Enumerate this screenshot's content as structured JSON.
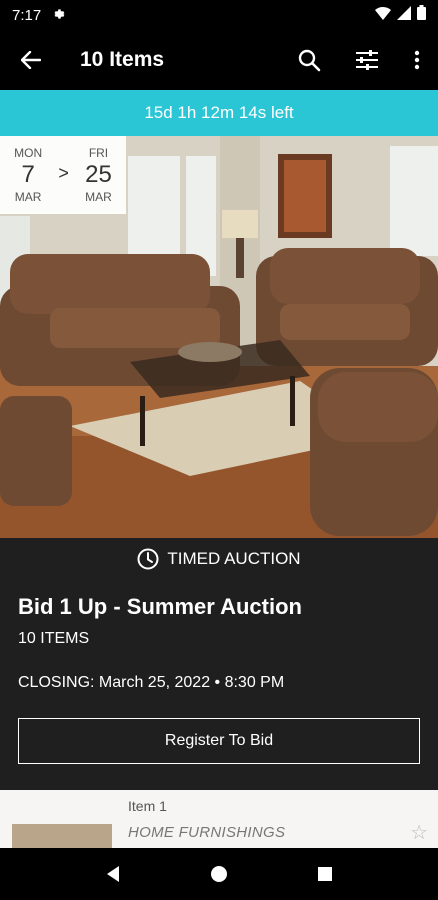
{
  "status_bar": {
    "time": "7:17"
  },
  "app_bar": {
    "title": "10 Items"
  },
  "timer": {
    "text": "15d 1h 12m 14s left"
  },
  "dates": {
    "start": {
      "dow": "MON",
      "day": "7",
      "month": "MAR"
    },
    "separator": ">",
    "end": {
      "dow": "FRI",
      "day": "25",
      "month": "MAR"
    }
  },
  "auction": {
    "type": "TIMED AUCTION",
    "title": "Bid 1 Up - Summer Auction",
    "item_count": "10 ITEMS",
    "closing": "CLOSING: March 25, 2022 • 8:30 PM",
    "register_label": "Register To Bid"
  },
  "list": {
    "items": [
      {
        "number": "Item 1",
        "category": "HOME FURNISHINGS"
      }
    ]
  },
  "colors": {
    "accent": "#2ac6d6",
    "info_bg": "#1f1f1f"
  }
}
